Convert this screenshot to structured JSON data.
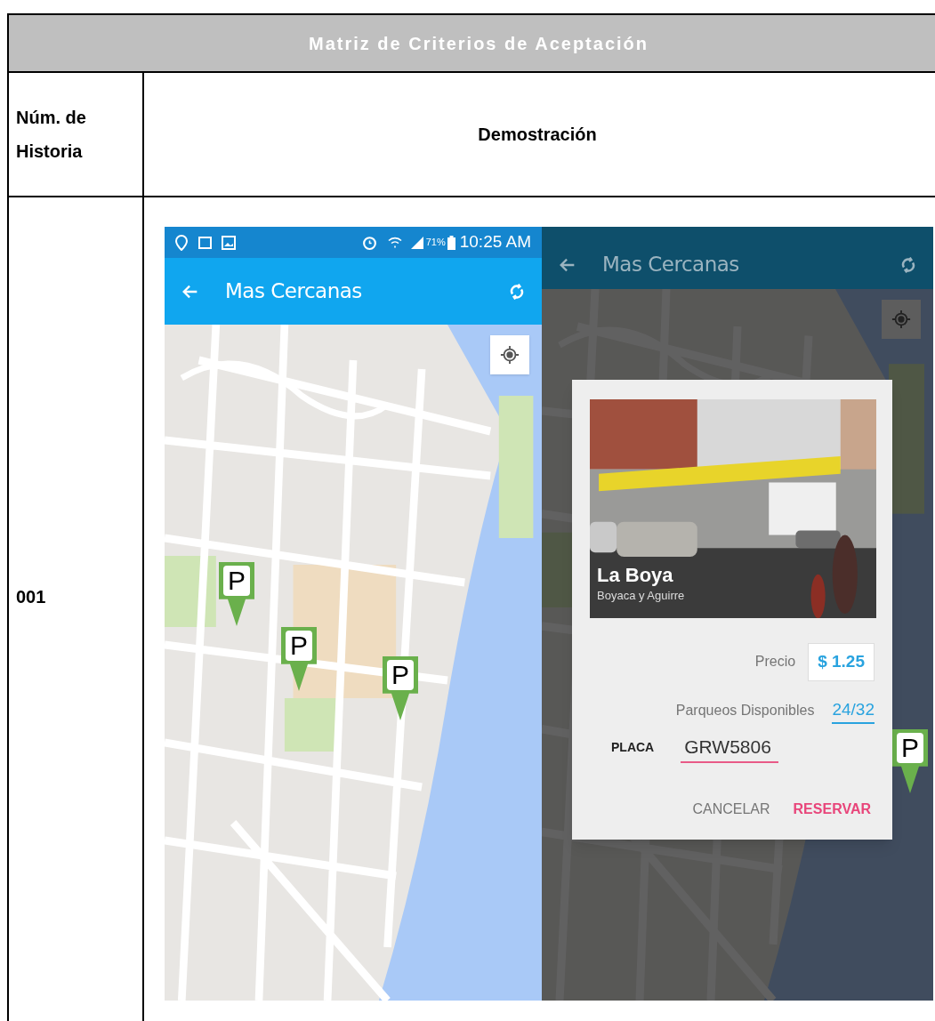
{
  "title": "Matriz de Criterios de Aceptación",
  "header": {
    "column_1": "Núm. de Historia",
    "column_2": "Demostración"
  },
  "rows": [
    {
      "number": "001",
      "left_screen": {
        "status_bar": {
          "battery": "71%",
          "time": "10:25 AM"
        },
        "app_bar": {
          "title": "Mas Cercanas"
        },
        "map": {
          "kind": "picture",
          "pins": [
            "P",
            "P",
            "P"
          ]
        }
      },
      "right_screen": {
        "app_bar": {
          "title": "Mas Cercanas"
        },
        "map": {
          "kind": "picture",
          "pins": [
            "P"
          ]
        },
        "dialog": {
          "photo": {
            "kind": "picture",
            "name": "La Boya",
            "address": "Boyaca y Aguirre"
          },
          "price_label": "Precio",
          "price": "$ 1.25",
          "availability_label": "Parqueos Disponibles",
          "availability": "24/32",
          "plate_label": "PLACA",
          "plate": "GRW5806",
          "buttons": [
            "CANCELAR",
            "RESERVAR"
          ]
        }
      }
    }
  ]
}
